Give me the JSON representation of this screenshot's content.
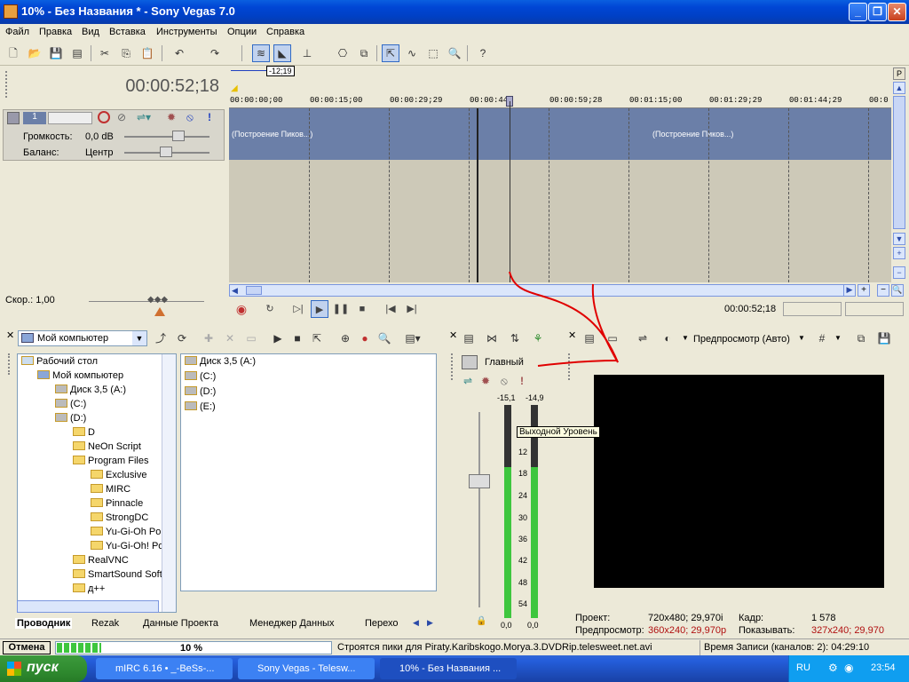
{
  "window": {
    "title": "10% - Без Названия * - Sony Vegas 7.0",
    "minimize": "_",
    "maximize": "❐",
    "close": "✕"
  },
  "menu": [
    "Файл",
    "Правка",
    "Вид",
    "Вставка",
    "Инструменты",
    "Опции",
    "Справка"
  ],
  "tracklist": {
    "timecode": "00:00:52;18",
    "track_number": "1",
    "volume_label": "Громкость:",
    "volume_value": "0,0 dB",
    "pan_label": "Баланс:",
    "pan_value": "Центр",
    "speed_label": "Скор.: 1,00"
  },
  "timeline": {
    "marker": "-12;19",
    "ruler": [
      "00:00:00;00",
      "00:00:15;00",
      "00:00:29;29",
      "00:00:44;",
      "00:00:59;28",
      "00:01:15;00",
      "00:01:29;29",
      "00:01:44;29",
      "00:0"
    ],
    "clip_text_1": "(Построение Пиков...)",
    "clip_text_2": "(Построение Пиков...)"
  },
  "transport": {
    "timecode": "00:00:52;18"
  },
  "explorer": {
    "location": "Мой компьютер",
    "tree": [
      "Рабочий стол",
      "Мой компьютер",
      "Диск 3,5 (A:)",
      "(C:)",
      "(D:)",
      "D",
      "NeOn Script",
      "Program Files",
      "Exclusive",
      "MIRC",
      "Pinnacle",
      "StrongDC",
      "Yu-Gi-Oh Po",
      "Yu-Gi-Oh! Po",
      "RealVNC",
      "SmartSound Soft",
      "д++"
    ],
    "files": [
      "Диск 3,5 (A:)",
      "(C:)",
      "(D:)",
      "(E:)"
    ],
    "tabs": [
      "Проводник",
      "Rezak",
      "Данные Проекта",
      "Менеджер Данных",
      "Перехо"
    ]
  },
  "mixer": {
    "master_label": "Главный",
    "peak_left": "-15,1",
    "peak_right": "-14,9",
    "tooltip": "Выходной Уровень",
    "scale": [
      "6",
      "12",
      "18",
      "24",
      "30",
      "36",
      "42",
      "48",
      "54"
    ],
    "bottom_left": "0,0",
    "bottom_right": "0,0"
  },
  "preview": {
    "mode": "Предпросмотр (Авто)",
    "project_label": "Проект:",
    "project_value": "720x480; 29,970i",
    "frame_label": "Кадр:",
    "frame_value": "1 578",
    "preview_label": "Предпросмотр:",
    "preview_value": "360x240; 29,970p",
    "display_label": "Показывать:",
    "display_value": "327x240; 29,970"
  },
  "statusbar": {
    "cancel": "Отмена",
    "percent": "10 %",
    "progress": 0.1,
    "message": "Строятся пики для Piraty.Karibskogo.Morya.3.DVDRip.telesweet.net.avi",
    "record_time": "Время Записи (каналов: 2): 04:29:10"
  },
  "taskbar": {
    "start": "пуск",
    "tasks": [
      "mIRC 6.16 • _-BeSs-...",
      "Sony Vegas - Telesw...",
      "10% - Без Названия ..."
    ],
    "lang": "RU",
    "clock": "23:54"
  },
  "colors": {
    "clip": "#6b7fa8",
    "annotation": "#e00000",
    "meter": "#3ec63e"
  }
}
